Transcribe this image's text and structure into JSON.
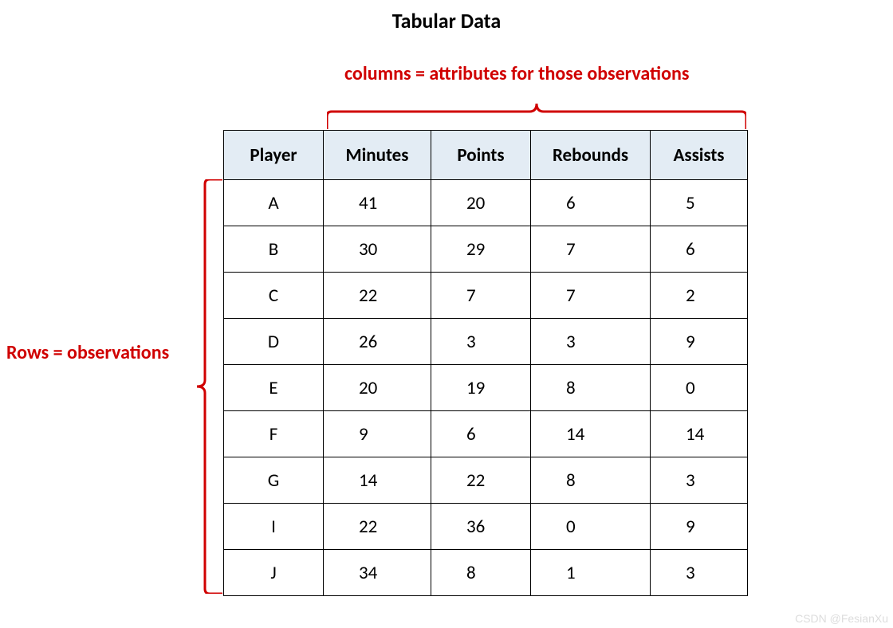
{
  "title": "Tabular Data",
  "columns_label": "columns = attributes for those observations",
  "rows_label": "Rows = observations",
  "watermark": "CSDN @FesianXu",
  "accent_color": "#d00000",
  "header_bg": "#e3ecf4",
  "chart_data": {
    "type": "table",
    "title": "Tabular Data",
    "columns": [
      "Player",
      "Minutes",
      "Points",
      "Rebounds",
      "Assists"
    ],
    "rows": [
      {
        "Player": "A",
        "Minutes": 41,
        "Points": 20,
        "Rebounds": 6,
        "Assists": 5
      },
      {
        "Player": "B",
        "Minutes": 30,
        "Points": 29,
        "Rebounds": 7,
        "Assists": 6
      },
      {
        "Player": "C",
        "Minutes": 22,
        "Points": 7,
        "Rebounds": 7,
        "Assists": 2
      },
      {
        "Player": "D",
        "Minutes": 26,
        "Points": 3,
        "Rebounds": 3,
        "Assists": 9
      },
      {
        "Player": "E",
        "Minutes": 20,
        "Points": 19,
        "Rebounds": 8,
        "Assists": 0
      },
      {
        "Player": "F",
        "Minutes": 9,
        "Points": 6,
        "Rebounds": 14,
        "Assists": 14
      },
      {
        "Player": "G",
        "Minutes": 14,
        "Points": 22,
        "Rebounds": 8,
        "Assists": 3
      },
      {
        "Player": "I",
        "Minutes": 22,
        "Points": 36,
        "Rebounds": 0,
        "Assists": 9
      },
      {
        "Player": "J",
        "Minutes": 34,
        "Points": 8,
        "Rebounds": 1,
        "Assists": 3
      }
    ]
  }
}
